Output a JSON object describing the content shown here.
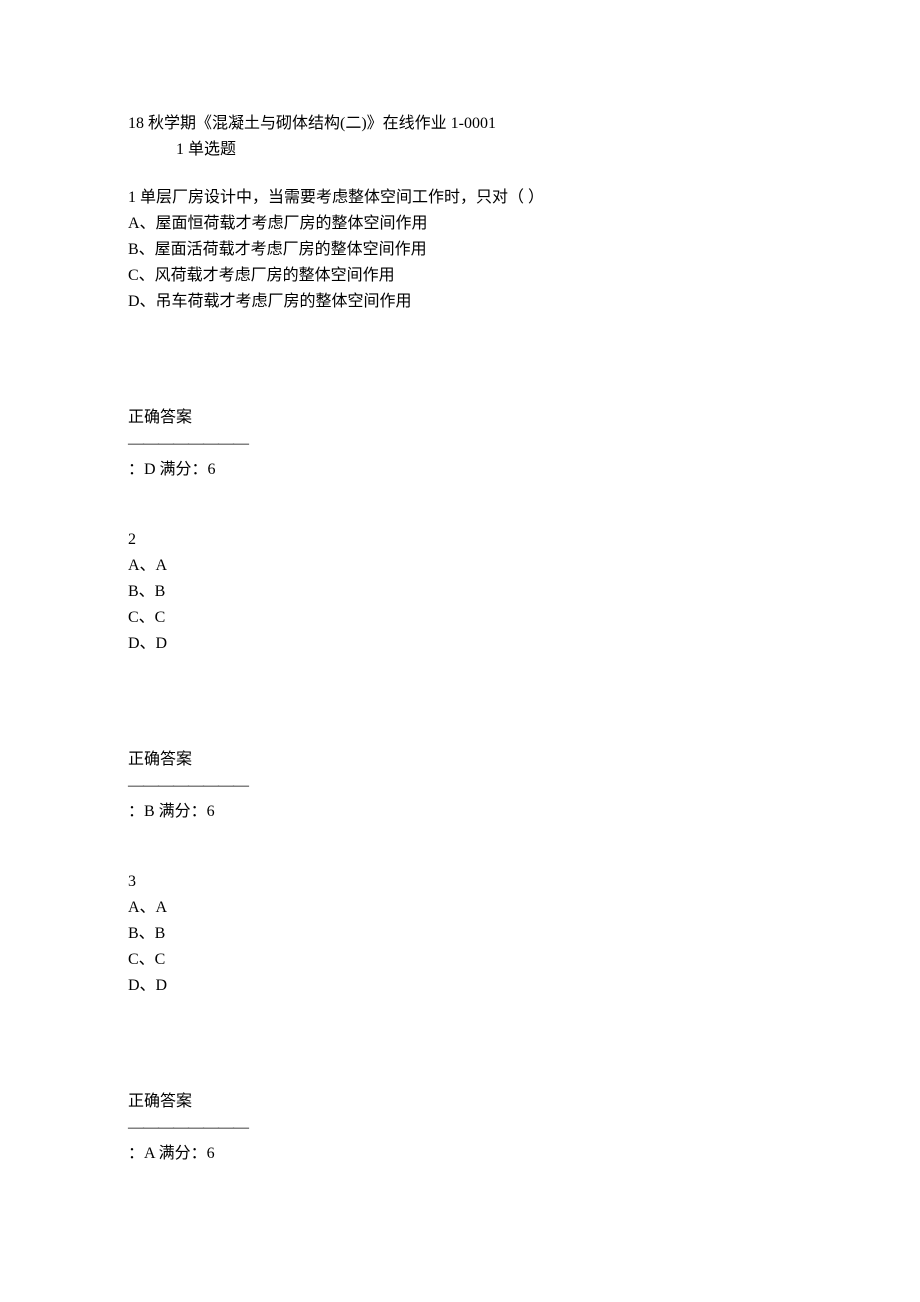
{
  "title": "18 秋学期《混凝土与砌体结构(二)》在线作业 1-0001",
  "sectionHeader": "1   单选题",
  "divider": "————————",
  "answerLabel": "正确答案",
  "questions": [
    {
      "num": "1",
      "stem": "  单层厂房设计中，当需要考虑整体空间工作时，只对（ ）",
      "options": [
        "A、屋面恒荷载才考虑厂房的整体空间作用",
        "B、屋面活荷载才考虑厂房的整体空间作用",
        "C、风荷载才考虑厂房的整体空间作用",
        "D、吊车荷载才考虑厂房的整体空间作用"
      ],
      "answer": "：D 满分：6"
    },
    {
      "num": "2",
      "stem": "",
      "options": [
        "A、A",
        "B、B",
        "C、C",
        "D、D"
      ],
      "answer": "：B 满分：6"
    },
    {
      "num": "3",
      "stem": "",
      "options": [
        "A、A",
        "B、B",
        "C、C",
        "D、D"
      ],
      "answer": "：A 满分：6"
    }
  ]
}
